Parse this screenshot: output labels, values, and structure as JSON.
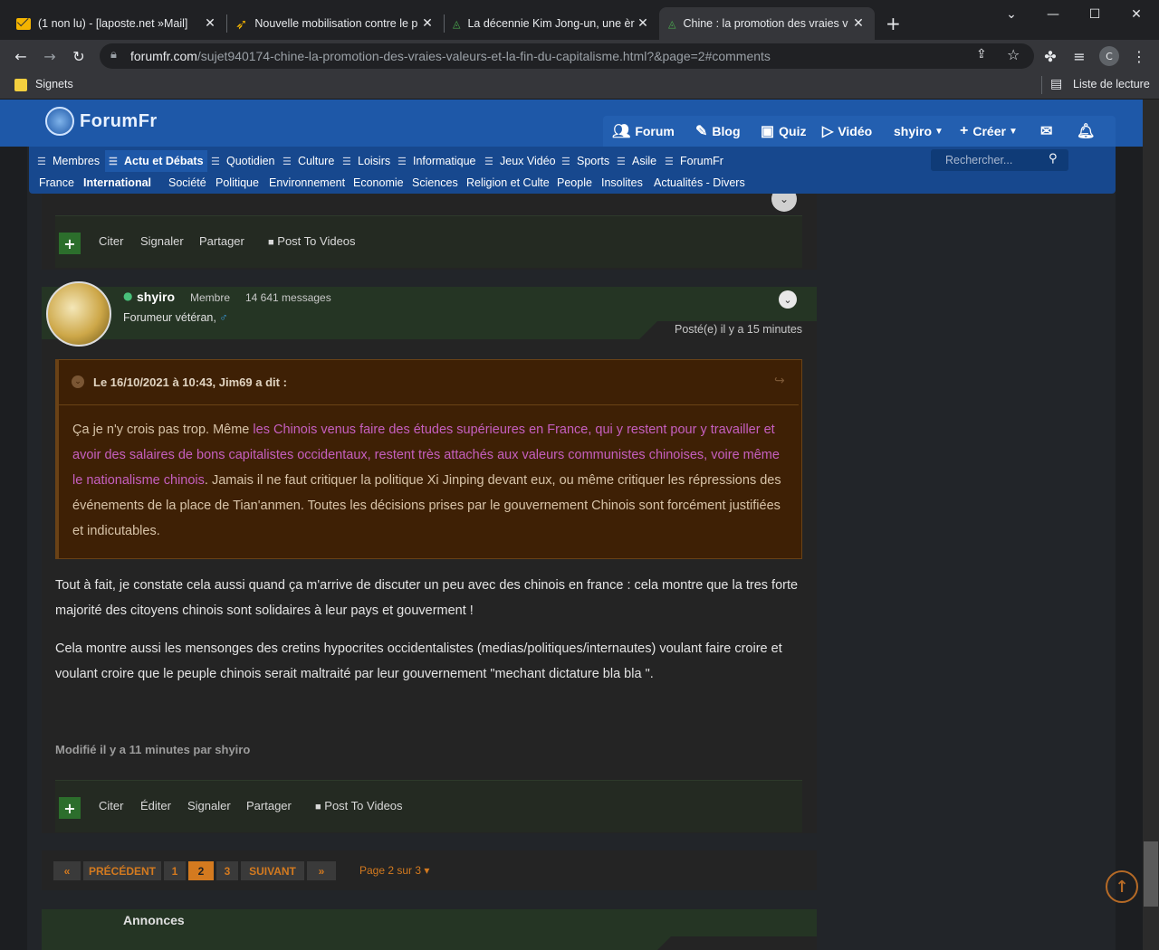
{
  "browser": {
    "tabs": [
      {
        "title": "(1 non lu) - [laposte.net »Mail]",
        "icon": "mail-icon"
      },
      {
        "title": "Nouvelle mobilisation contre le p",
        "icon": "arrow-icon"
      },
      {
        "title": "La décennie Kim Jong-un, une èr",
        "icon": "forum-icon"
      },
      {
        "title": "Chine : la promotion des vraies v",
        "icon": "forum-icon"
      }
    ],
    "url_domain": "forumfr.com",
    "url_path": "/sujet940174-chine-la-promotion-des-vraies-valeurs-et-la-fin-du-capitalisme.html?&page=2#comments",
    "bookmark": "Signets",
    "reading_list": "Liste de lecture",
    "profile_initial": "C"
  },
  "site": {
    "logo": "ForumFr",
    "nav": {
      "forum": "Forum",
      "blog": "Blog",
      "quiz": "Quiz",
      "video": "Vidéo",
      "user": "shyiro",
      "create": "Créer"
    },
    "categories": [
      "Membres",
      "Actu et Débats",
      "Quotidien",
      "Culture",
      "Loisirs",
      "Informatique",
      "Jeux Vidéo",
      "Sports",
      "Asile",
      "ForumFr"
    ],
    "subcategories": [
      "France",
      "International",
      "Société",
      "Politique",
      "Environnement",
      "Economie",
      "Sciences",
      "Religion et Culte",
      "People",
      "Insolites",
      "Actualités - Divers"
    ],
    "search_placeholder": "Rechercher..."
  },
  "actions_prev": {
    "plus": "+",
    "quote": "Citer",
    "report": "Signaler",
    "share": "Partager",
    "video": "Post To Videos"
  },
  "post": {
    "author": "shyiro",
    "role": "Membre",
    "messages": "14 641 messages",
    "rank": "Forumeur vétéran,",
    "posted": "Posté(e) il y a 15 minutes",
    "quote_header": "Le 16/10/2021 à 10:43, Jim69 a dit :",
    "quote_pre": "Ça je n'y crois pas trop. Même ",
    "quote_link": "les Chinois venus faire des études supérieures en France, qui y restent pour y travailler et avoir des salaires de bons capitalistes occidentaux, restent très attachés aux valeurs communistes chinoises, voire même le nationalisme chinois",
    "quote_post": ". Jamais il ne faut critiquer la politique Xi Jinping devant eux, ou même critiquer les répressions des événements de la place de Tian'anmen. Toutes les décisions prises par le gouvernement Chinois sont forcément justifiées et indicutables.",
    "paragraph1": "Tout à fait, je constate cela aussi quand ça m'arrive de discuter un peu avec des chinois en france : cela montre que la tres forte majorité des citoyens chinois sont solidaires à leur pays et gouverment !",
    "paragraph2": "Cela montre aussi les mensonges des cretins hypocrites occidentalistes (medias/politiques/internautes) voulant faire croire et voulant croire que le peuple chinois serait maltraité par leur gouvernement \"mechant dictature bla bla \".",
    "modified": "Modifié il y a 11 minutes par shyiro",
    "actions": {
      "plus": "+",
      "quote": "Citer",
      "edit": "Éditer",
      "report": "Signaler",
      "share": "Partager",
      "video": "Post To Videos"
    }
  },
  "pagination": {
    "first": "«",
    "prev": "PRÉCÉDENT",
    "pages": [
      "1",
      "2",
      "3"
    ],
    "current": "2",
    "next": "SUIVANT",
    "last": "»",
    "info": "Page 2 sur 3"
  },
  "announcements": "Annonces"
}
